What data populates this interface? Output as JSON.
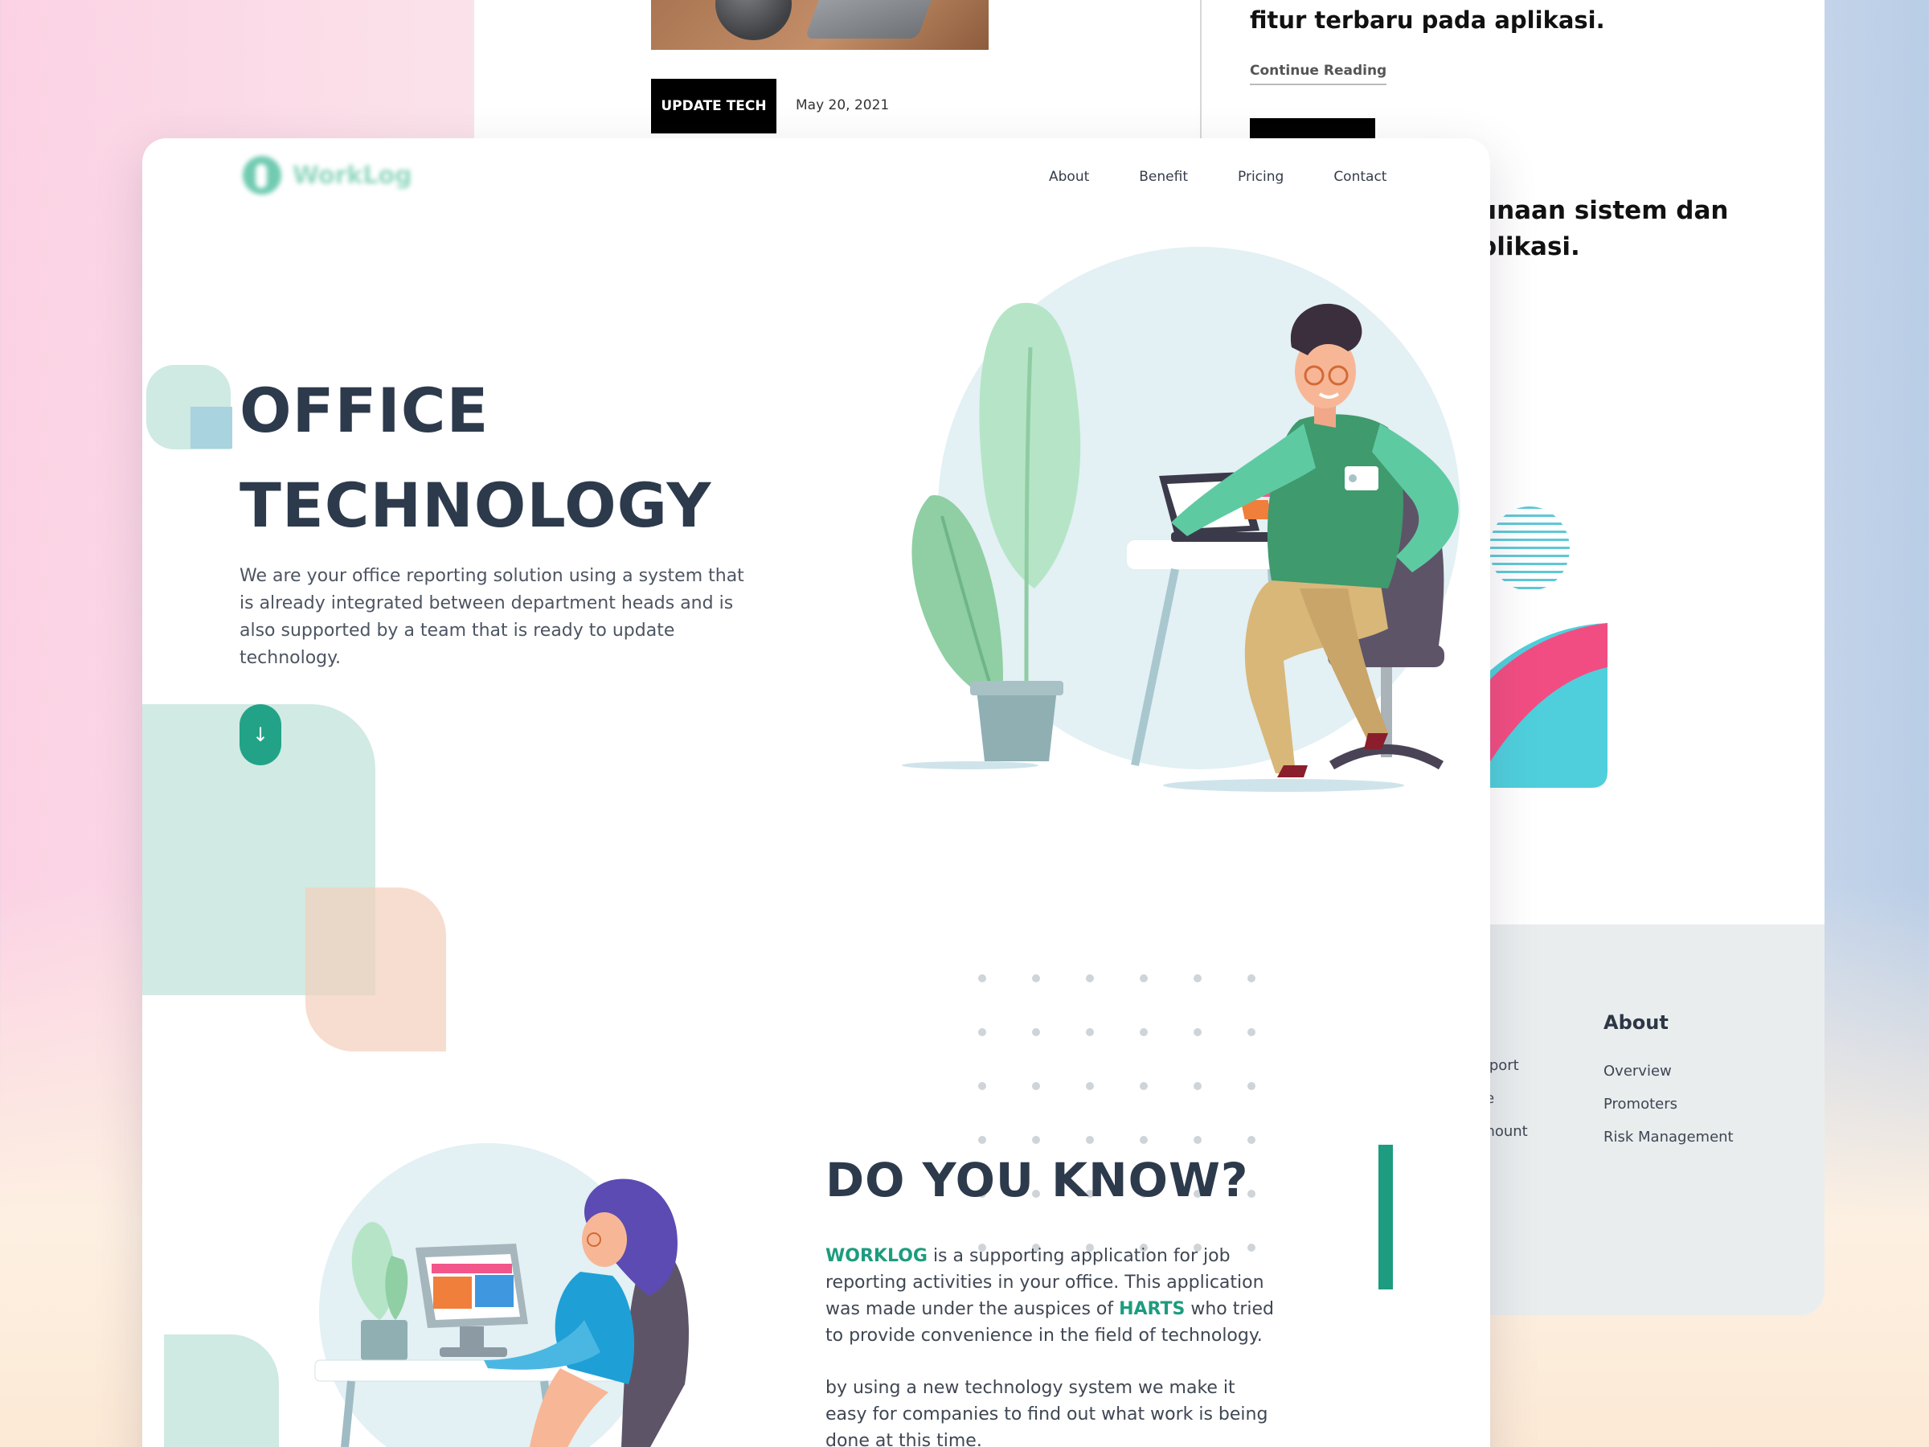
{
  "back": {
    "tag": "UPDATE TECH",
    "date": "May 20, 2021",
    "headline_tail": "fitur terbaru pada aplikasi.",
    "continue": "Continue Reading",
    "headline2_line1": "unaan sistem dan",
    "headline2_line2": "plikasi.",
    "footer": {
      "col1": [
        "upport",
        "ote",
        "Amount"
      ],
      "col2_heading": "About",
      "col2": [
        "Overview",
        "Promoters",
        "Risk Management"
      ]
    }
  },
  "card": {
    "logo": "WorkLog",
    "nav": [
      "About",
      "Benefit",
      "Pricing",
      "Contact"
    ],
    "hero_title_line1": "OFFICE",
    "hero_title_line2": "TECHNOLOGY",
    "hero_body": "We are your office reporting solution using a system that is already integrated between department heads and is also supported by a team that is ready to update technology.",
    "scroll_icon": "↓",
    "know_title": "DO YOU KNOW?",
    "know_p1": {
      "brand": "WORKLOG",
      "text_a": " is a supporting application for job reporting activities in your office. This application was made under the auspices of ",
      "partner": "HARTS",
      "text_b": " who tried to provide convenience in the field of technology."
    },
    "know_p2": "by using a new technology system we make it easy for companies to find out what work is being done at this time."
  },
  "colors": {
    "accent": "#1d9c7f",
    "heading": "#2c3a4c",
    "mint": "#cfe9e3",
    "peach": "#f3cfba"
  }
}
